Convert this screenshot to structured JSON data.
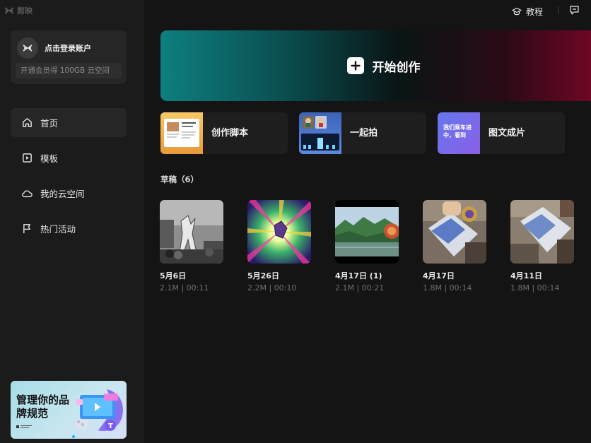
{
  "app": {
    "name": "剪映"
  },
  "account": {
    "login_label": "点击登录账户",
    "vip_promo": "开通会员得 100GB 云空间"
  },
  "nav": {
    "items": [
      {
        "label": "首页",
        "icon": "home-icon",
        "active": true
      },
      {
        "label": "模板",
        "icon": "template-icon",
        "active": false
      },
      {
        "label": "我的云空间",
        "icon": "cloud-icon",
        "active": false
      },
      {
        "label": "热门活动",
        "icon": "flag-icon",
        "active": false
      }
    ]
  },
  "ad": {
    "title": "管理你的品牌规范",
    "badge": "T"
  },
  "topbar": {
    "tutorial_label": "教程"
  },
  "main": {
    "start_create_label": "开始创作",
    "quick_actions": [
      {
        "label": "创作脚本",
        "thumb_text": "主题\n主题"
      },
      {
        "label": "一起拍"
      },
      {
        "label": "图文成片",
        "thumb_text": "我们乘车进中，看到"
      }
    ],
    "drafts_title": "草稿（6）",
    "drafts": [
      {
        "date": "5月6日",
        "meta": "2.1M | 00:11"
      },
      {
        "date": "5月26日",
        "meta": "2.2M | 00:10"
      },
      {
        "date": "4月17日 (1)",
        "meta": "2.1M | 00:21"
      },
      {
        "date": "4月17日",
        "meta": "1.8M | 00:14"
      },
      {
        "date": "4月11日",
        "meta": "1.8M | 00:14"
      }
    ]
  },
  "colors": {
    "sidebar_bg": "#1b1b1b",
    "main_bg": "#141414",
    "card_bg": "#262626",
    "accent_teal": "#0f7f7f",
    "accent_crimson": "#6e0624"
  }
}
